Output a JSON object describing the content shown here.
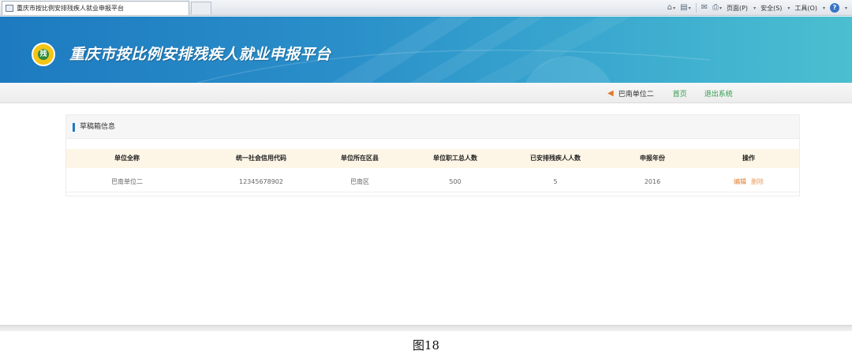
{
  "browser": {
    "tab_title": "重庆市按比例安排残疾人就业申报平台",
    "toolbar": {
      "page_menu": "页面(P)",
      "safety_menu": "安全(S)",
      "tools_menu": "工具(O)",
      "help_label": "?"
    }
  },
  "header": {
    "logo_glyph": "残",
    "title": "重庆市按比例安排残疾人就业申报平台"
  },
  "nav": {
    "user": "巴南单位二",
    "home": "首页",
    "logout": "退出系统"
  },
  "card": {
    "title": "草稿箱信息"
  },
  "table": {
    "columns": [
      "单位全称",
      "统一社会信用代码",
      "单位所在区县",
      "单位职工总人数",
      "已安排残疾人人数",
      "申报年份",
      "操作"
    ],
    "rows": [
      {
        "name": "巴南单位二",
        "credit_code": "12345678902",
        "district": "巴南区",
        "total_staff": "500",
        "disabled_count": "5",
        "year": "2016",
        "edit": "编辑",
        "delete": "删除"
      }
    ]
  },
  "caption": "图18",
  "colors": {
    "banner_start": "#1d7ac0",
    "banner_end": "#4bbfd0",
    "accent_green": "#2e9b4a",
    "action_orange": "#e07b2a",
    "header_accent": "#1f79c1"
  }
}
